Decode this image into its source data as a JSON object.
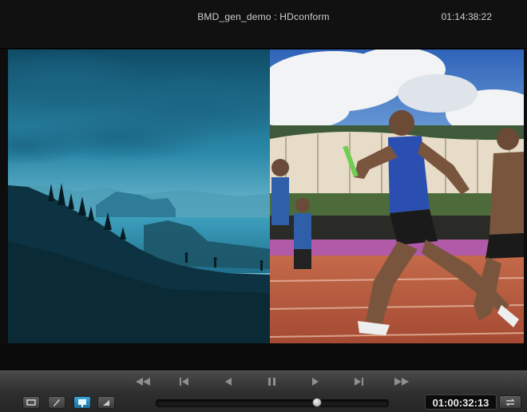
{
  "header": {
    "clip_title": "BMD_gen_demo : HDconform",
    "source_timecode": "01:14:38:22"
  },
  "viewer": {
    "left_image": "coastal-landscape-silhouette",
    "right_image": "sprinters-running-on-track"
  },
  "transport": {
    "buttons": [
      "fast-rewind",
      "go-to-start",
      "play-reverse",
      "pause",
      "play",
      "go-to-end",
      "fast-forward"
    ]
  },
  "tools": [
    "loop-icon",
    "pen-icon",
    "display-icon",
    "audio-icon"
  ],
  "scrubber": {
    "position_fraction": 0.7
  },
  "timecode": "01:00:32:13",
  "colors": {
    "accent": "#2a8fc4",
    "panel": "#3a3a3a"
  }
}
